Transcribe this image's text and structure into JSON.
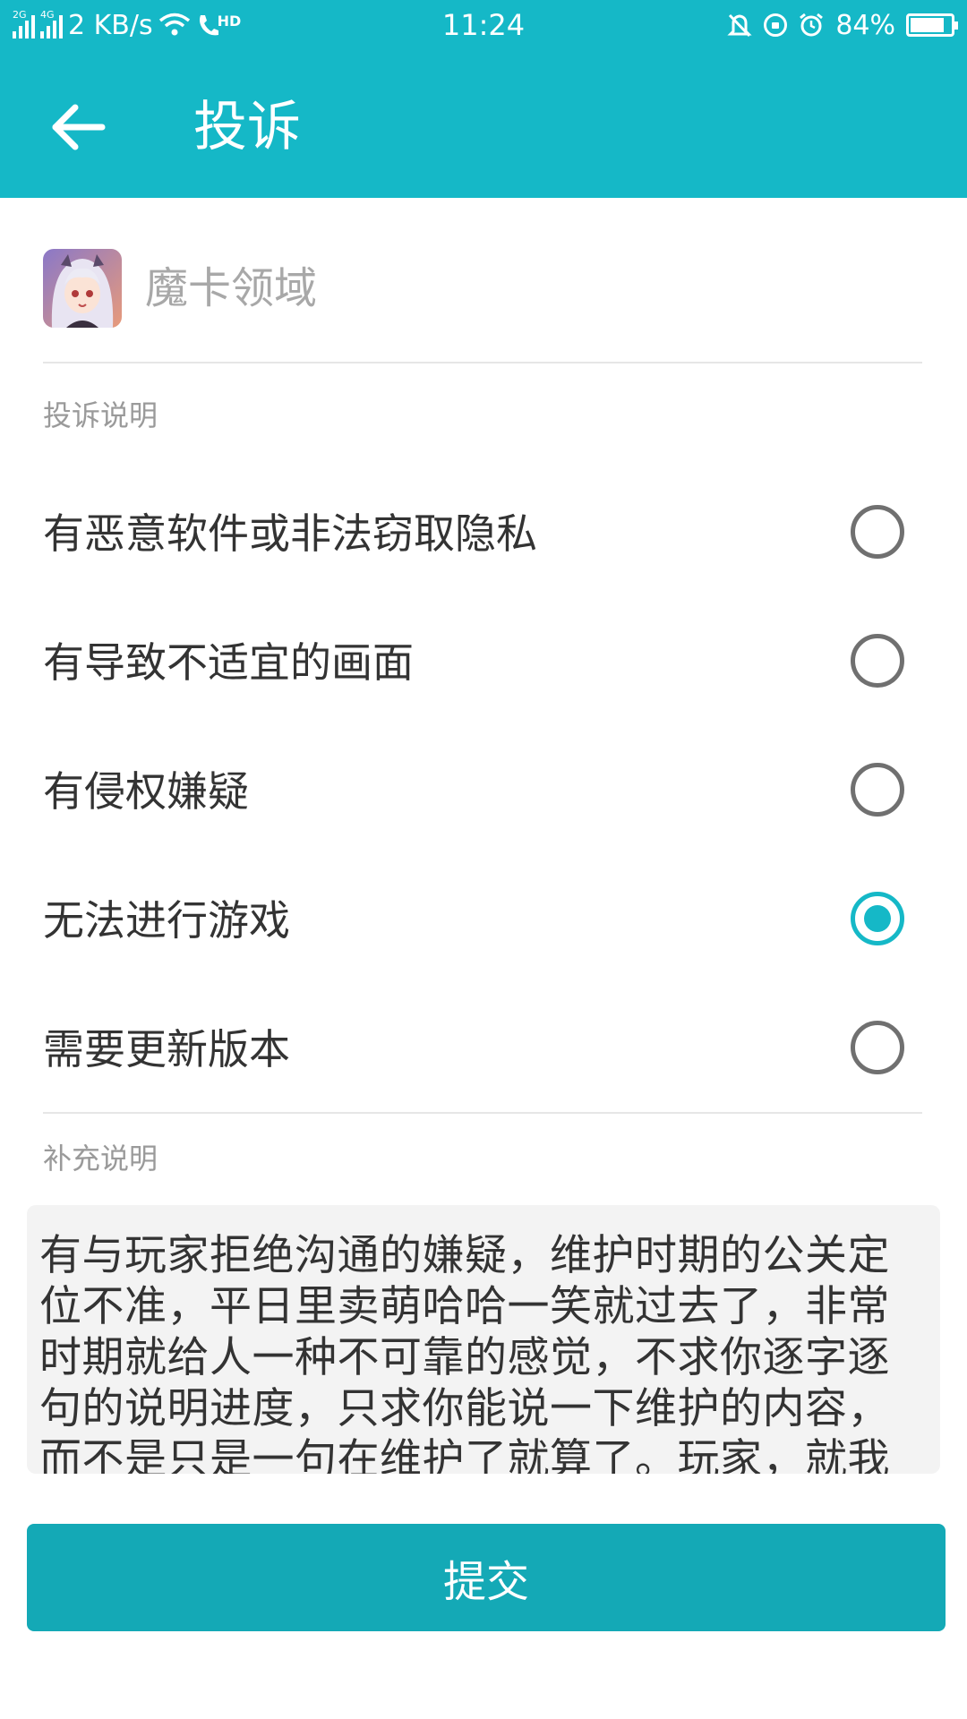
{
  "status_bar": {
    "network_1": "2G",
    "network_2": "4G",
    "speed": "2 KB/s",
    "call_badge": "HD",
    "time": "11:24",
    "battery": "84%",
    "battery_level": 0.84
  },
  "header": {
    "back_icon": "arrow-left-icon",
    "title": "投诉"
  },
  "app": {
    "name": "魔卡领域",
    "icon": "app-avatar-icon"
  },
  "complaint": {
    "section_label": "投诉说明",
    "options": [
      {
        "label": "有恶意软件或非法窃取隐私",
        "checked": false
      },
      {
        "label": "有导致不适宜的画面",
        "checked": false
      },
      {
        "label": "有侵权嫌疑",
        "checked": false
      },
      {
        "label": "无法进行游戏",
        "checked": true
      },
      {
        "label": "需要更新版本",
        "checked": false
      }
    ]
  },
  "supplement": {
    "section_label": "补充说明",
    "text": "有与玩家拒绝沟通的嫌疑，维护时期的公关定位不准，平日里卖萌哈哈一笑就过去了，非常时期就给人一种不可靠的感觉，不求你逐字逐句的说明进度，只求你能说一下维护的内容，而不是只是一句在维护了就算了。玩家，就我"
  },
  "submit": {
    "label": "提交"
  },
  "colors": {
    "primary": "#15b8c7",
    "button": "#14a9b6"
  }
}
